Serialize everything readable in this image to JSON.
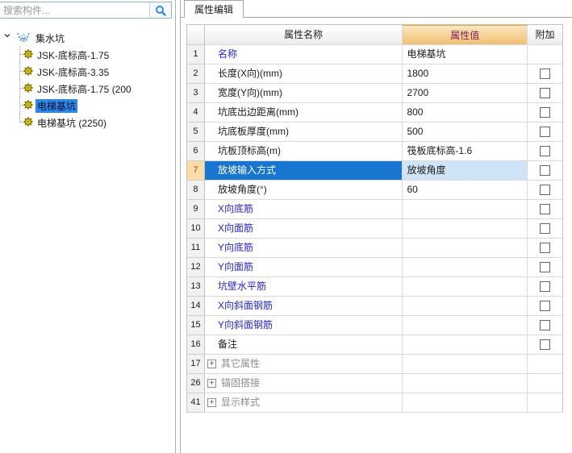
{
  "search": {
    "placeholder": "搜索构件...",
    "icon": "magnifier-icon"
  },
  "tree": {
    "root": {
      "label": "集水坑",
      "expanded": true,
      "icon": "sump-pit-icon"
    },
    "items": [
      {
        "label": "JSK-底标高-1.75",
        "selected": false
      },
      {
        "label": "JSK-底标高-3.35",
        "selected": false
      },
      {
        "label": "JSK-底标高-1.75 (200",
        "selected": false
      },
      {
        "label": "电梯基坑",
        "selected": true
      },
      {
        "label": "电梯基坑 (2250)",
        "selected": false
      }
    ]
  },
  "panel": {
    "tab_label": "属性编辑"
  },
  "table": {
    "headers": {
      "index": "",
      "name": "属性名称",
      "value": "属性值",
      "attach": "附加"
    },
    "expand_glyph": "+",
    "rows": [
      {
        "num": "1",
        "name": "名称",
        "value": "电梯基坑",
        "style": "link",
        "attach": false,
        "selected": false
      },
      {
        "num": "2",
        "name": "长度(X向)(mm)",
        "value": "1800",
        "style": "normal",
        "attach": true,
        "selected": false
      },
      {
        "num": "3",
        "name": "宽度(Y向)(mm)",
        "value": "2700",
        "style": "normal",
        "attach": true,
        "selected": false
      },
      {
        "num": "4",
        "name": "坑底出边距离(mm)",
        "value": "800",
        "style": "normal",
        "attach": true,
        "selected": false
      },
      {
        "num": "5",
        "name": "坑底板厚度(mm)",
        "value": "500",
        "style": "normal",
        "attach": true,
        "selected": false
      },
      {
        "num": "6",
        "name": "坑板顶标高(m)",
        "value": "筏板底标高-1.6",
        "style": "normal",
        "attach": true,
        "selected": false
      },
      {
        "num": "7",
        "name": "放坡输入方式",
        "value": "放坡角度",
        "style": "normal",
        "attach": true,
        "selected": true
      },
      {
        "num": "8",
        "name": "放坡角度(°)",
        "value": "60",
        "style": "normal",
        "attach": true,
        "selected": false
      },
      {
        "num": "9",
        "name": "X向底筋",
        "value": "",
        "style": "link",
        "attach": true,
        "selected": false
      },
      {
        "num": "10",
        "name": "X向面筋",
        "value": "",
        "style": "link",
        "attach": true,
        "selected": false
      },
      {
        "num": "11",
        "name": "Y向底筋",
        "value": "",
        "style": "link",
        "attach": true,
        "selected": false
      },
      {
        "num": "12",
        "name": "Y向面筋",
        "value": "",
        "style": "link",
        "attach": true,
        "selected": false
      },
      {
        "num": "13",
        "name": "坑壁水平筋",
        "value": "",
        "style": "link",
        "attach": true,
        "selected": false
      },
      {
        "num": "14",
        "name": "X向斜面钢筋",
        "value": "",
        "style": "link",
        "attach": true,
        "selected": false
      },
      {
        "num": "15",
        "name": "Y向斜面钢筋",
        "value": "",
        "style": "link",
        "attach": true,
        "selected": false
      },
      {
        "num": "16",
        "name": "备注",
        "value": "",
        "style": "normal",
        "attach": true,
        "selected": false
      },
      {
        "num": "17",
        "name": "其它属性",
        "value": "",
        "style": "group",
        "attach": false,
        "selected": false
      },
      {
        "num": "26",
        "name": "锚固搭接",
        "value": "",
        "style": "group",
        "attach": false,
        "selected": false
      },
      {
        "num": "41",
        "name": "显示样式",
        "value": "",
        "style": "group",
        "attach": false,
        "selected": false
      }
    ]
  },
  "colors": {
    "selection_blue": "#1875d0",
    "tree_selection_blue": "#2e86e9",
    "selected_value_bg": "#cfe4f7",
    "selected_num_bg": "#fbdca8",
    "selected_num_text": "#c03a00",
    "value_header_bg": "#f0bf72",
    "value_header_text": "#7e1d5a",
    "link_blue": "#2525d6",
    "group_gray": "#8c8c8c",
    "gear_yellow": "#e8d200",
    "search_icon_blue": "#2d8bdc"
  }
}
